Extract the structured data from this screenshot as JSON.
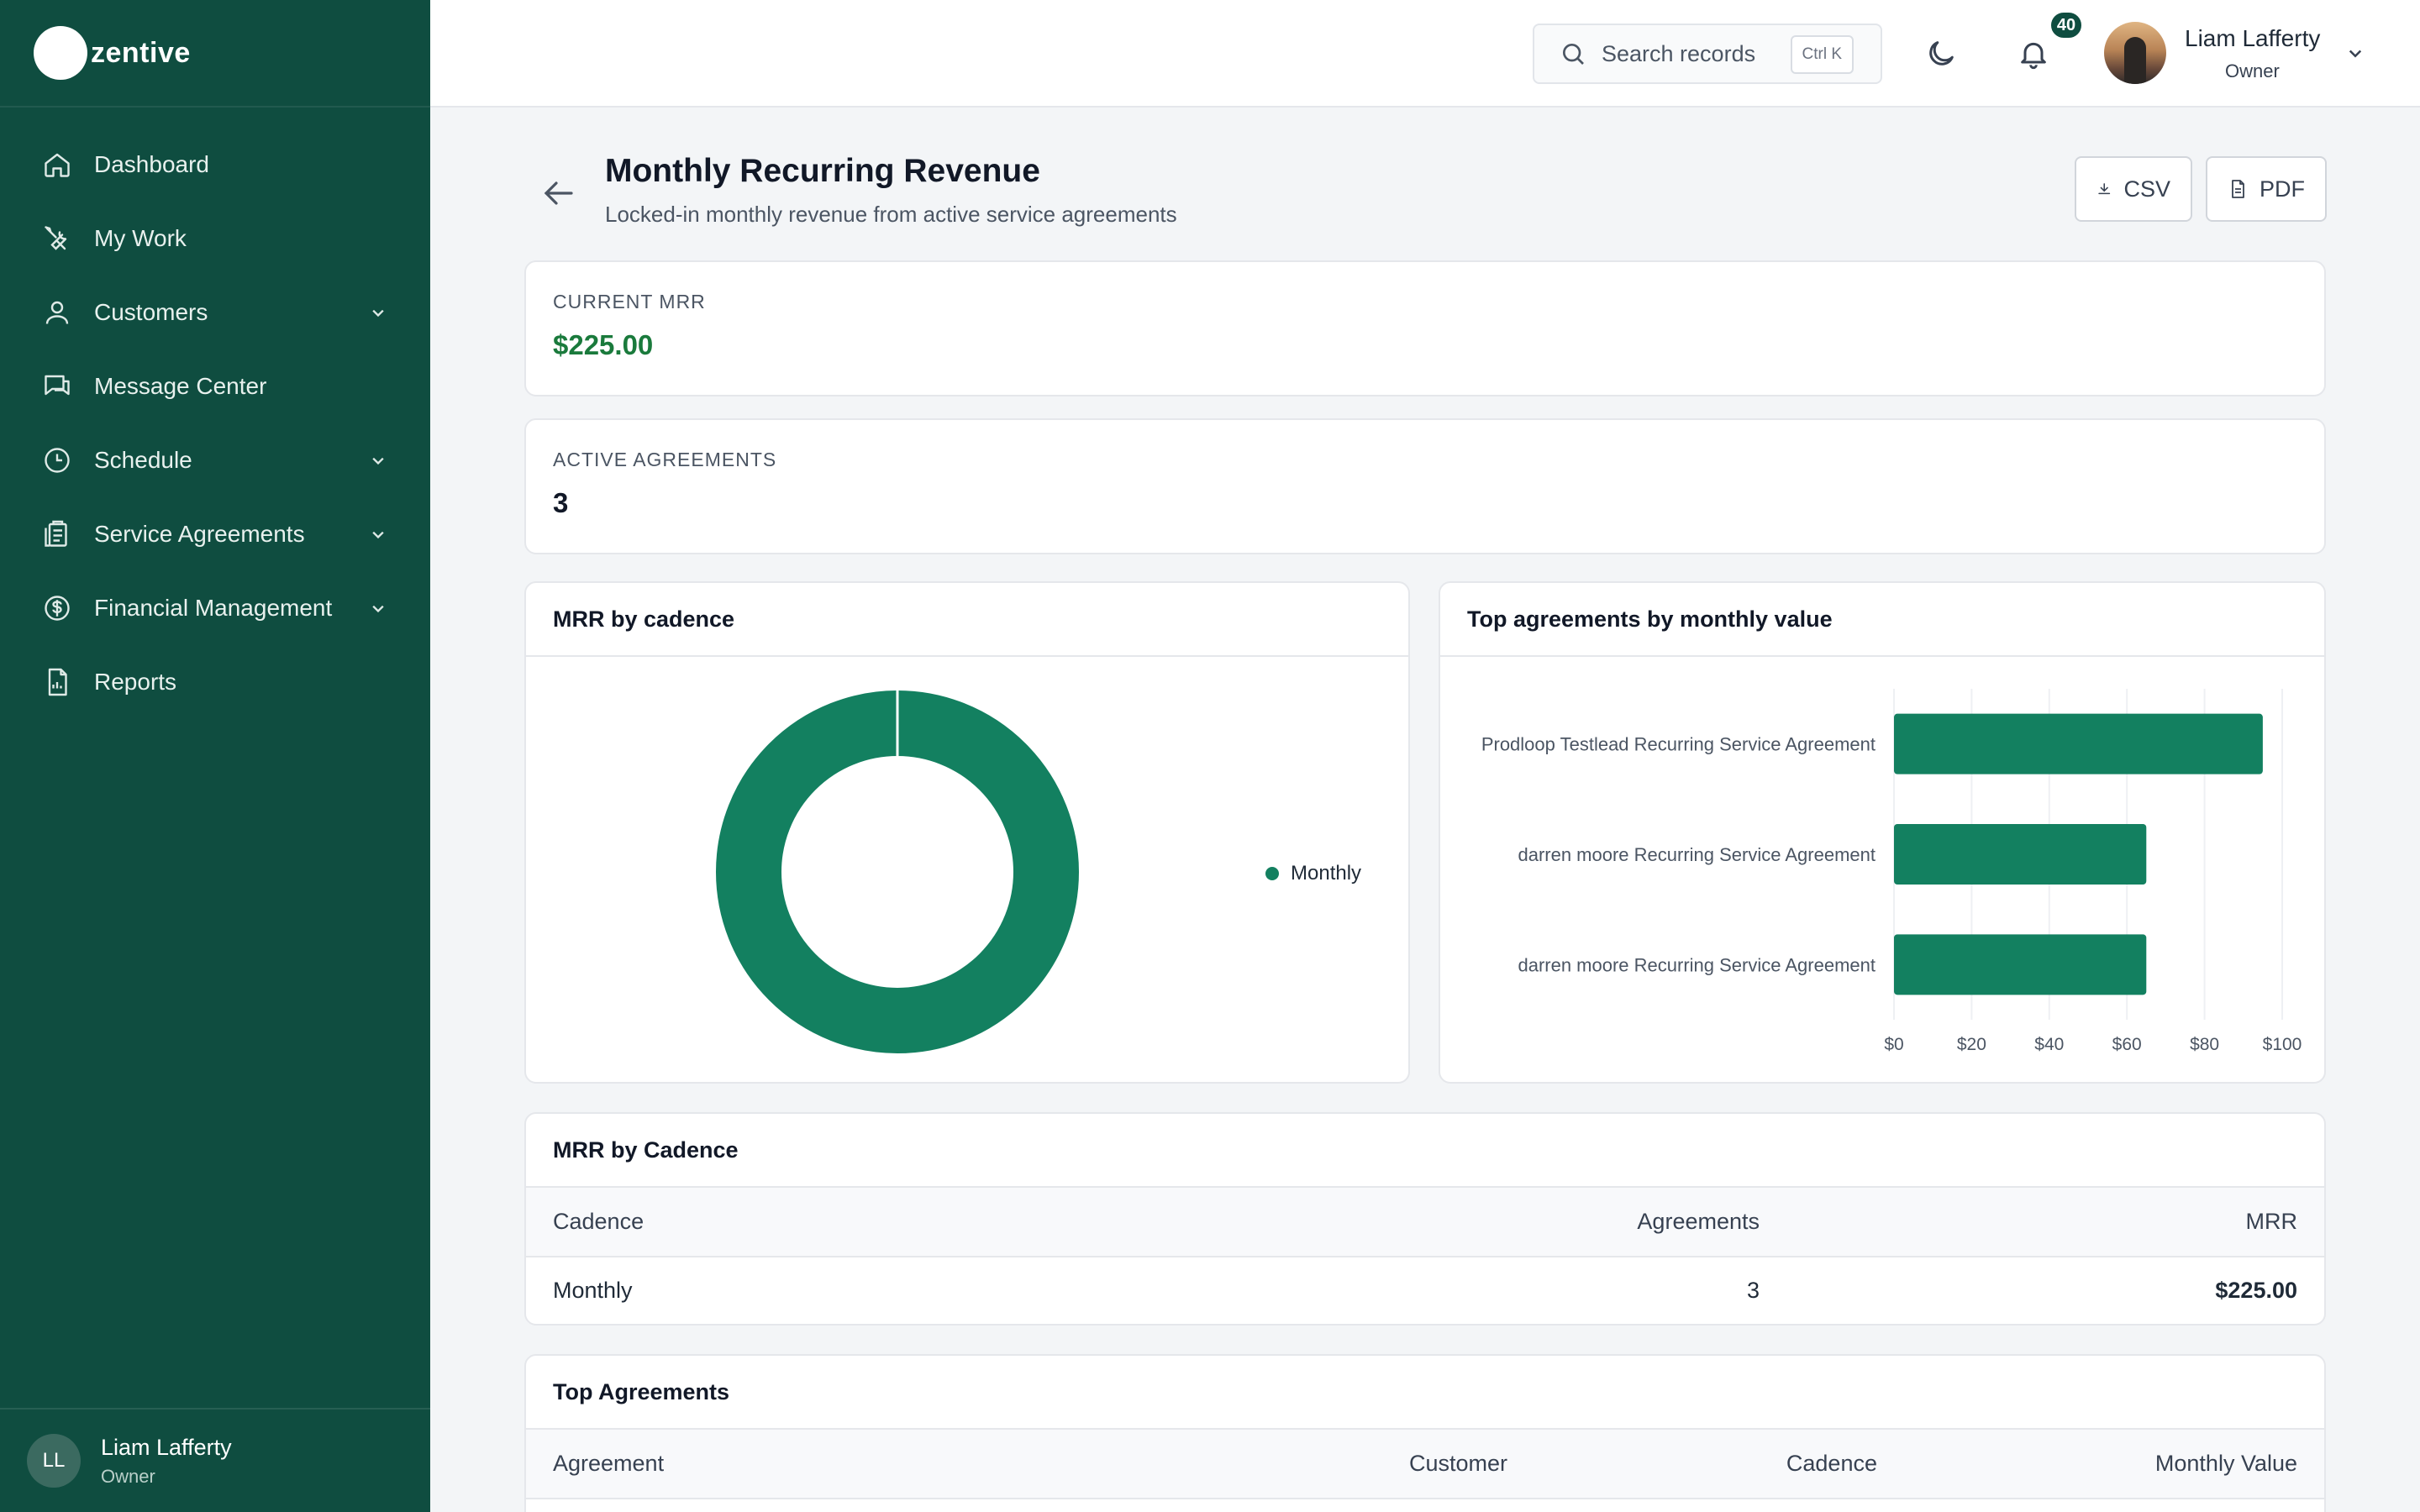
{
  "brand": {
    "name": "zentive"
  },
  "sidebar": {
    "items": [
      {
        "label": "Dashboard",
        "icon": "home-icon",
        "expandable": false
      },
      {
        "label": "My Work",
        "icon": "tools-icon",
        "expandable": false
      },
      {
        "label": "Customers",
        "icon": "users-icon",
        "expandable": true
      },
      {
        "label": "Message Center",
        "icon": "chat-icon",
        "expandable": false
      },
      {
        "label": "Schedule",
        "icon": "clock-icon",
        "expandable": true
      },
      {
        "label": "Service Agreements",
        "icon": "clipboard-icon",
        "expandable": true
      },
      {
        "label": "Financial Management",
        "icon": "dollar-icon",
        "expandable": true
      },
      {
        "label": "Reports",
        "icon": "report-icon",
        "expandable": false
      }
    ],
    "footer": {
      "initials": "LL",
      "name": "Liam Lafferty",
      "role": "Owner"
    }
  },
  "header": {
    "search": {
      "placeholder": "Search records",
      "shortcut": "Ctrl K"
    },
    "notifications": {
      "count": "40"
    },
    "user": {
      "name": "Liam Lafferty",
      "role": "Owner"
    }
  },
  "page": {
    "title": "Monthly Recurring Revenue",
    "subtitle": "Locked-in monthly revenue from active service agreements",
    "actions": {
      "csv": "CSV",
      "pdf": "PDF"
    }
  },
  "stats": {
    "current_mrr": {
      "label": "CURRENT MRR",
      "value": "$225.00"
    },
    "active_agreements": {
      "label": "ACTIVE AGREEMENTS",
      "value": "3"
    }
  },
  "colors": {
    "accent": "#138060",
    "sidebar": "#0f4d40",
    "positive_text": "#1a7a3c"
  },
  "charts": {
    "cadence_title": "MRR by cadence",
    "top_title": "Top agreements by monthly value"
  },
  "chart_data": [
    {
      "type": "pie",
      "title": "MRR by cadence",
      "labels": [
        "Monthly"
      ],
      "values": [
        225
      ],
      "legend_position": "right"
    },
    {
      "type": "bar",
      "orientation": "horizontal",
      "title": "Top agreements by monthly value",
      "categories": [
        "Prodloop Testlead Recurring Service Agreement",
        "darren moore Recurring Service Agreement",
        "darren moore Recurring Service Agreement"
      ],
      "values": [
        95,
        65,
        65
      ],
      "xlim": [
        0,
        100
      ],
      "xticks": [
        "$0",
        "$20",
        "$40",
        "$60",
        "$80",
        "$100"
      ],
      "grid": true
    }
  ],
  "cadence_table": {
    "title": "MRR by Cadence",
    "headers": [
      "Cadence",
      "Agreements",
      "MRR"
    ],
    "rows": [
      [
        "Monthly",
        "3",
        "$225.00"
      ]
    ]
  },
  "top_table": {
    "title": "Top Agreements",
    "headers": [
      "Agreement",
      "Customer",
      "Cadence",
      "Monthly Value"
    ]
  }
}
